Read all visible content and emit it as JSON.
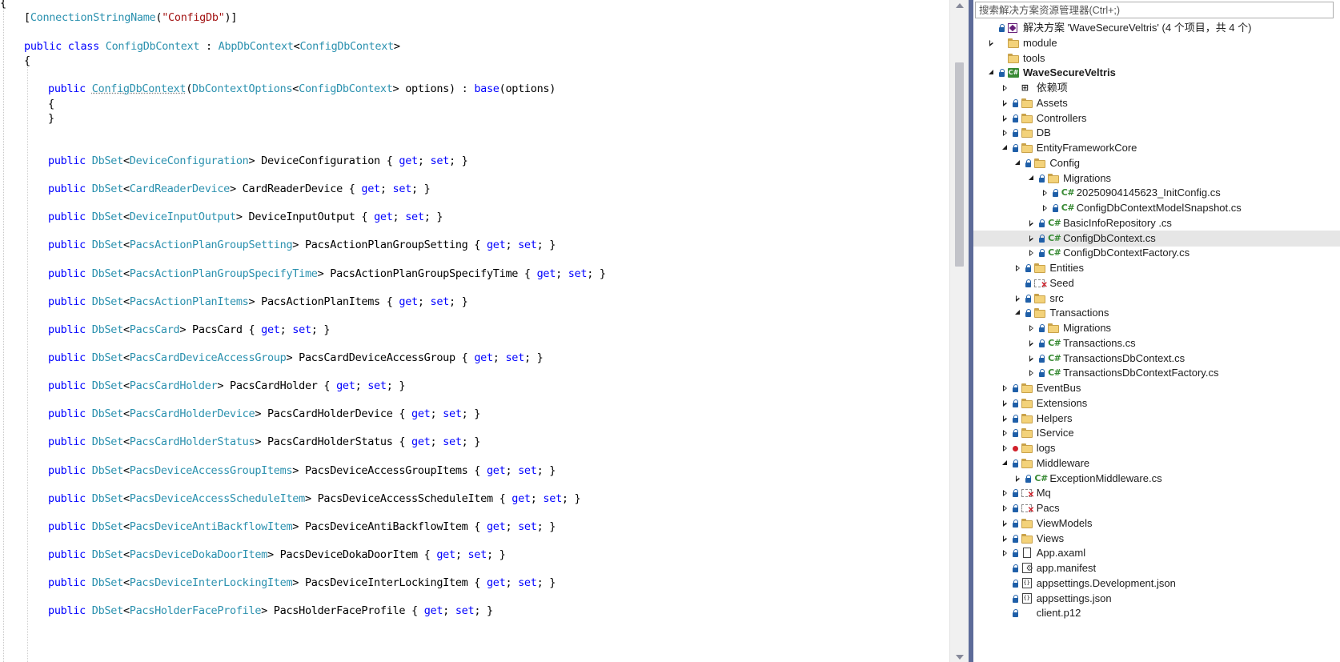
{
  "editor": {
    "lines": [
      [
        {
          "t": "[",
          "c": "pu"
        },
        {
          "t": "ConnectionStringName",
          "c": "ty"
        },
        {
          "t": "(",
          "c": "pu"
        },
        {
          "t": "\"ConfigDb\"",
          "c": "st"
        },
        {
          "t": ")]",
          "c": "pu"
        }
      ],
      [
        {
          "t": "public ",
          "c": "kw"
        },
        {
          "t": "class ",
          "c": "kw"
        },
        {
          "t": "ConfigDbContext",
          "c": "ty"
        },
        {
          "t": " : ",
          "c": "pu"
        },
        {
          "t": "AbpDbContext",
          "c": "ty"
        },
        {
          "t": "<",
          "c": "pu"
        },
        {
          "t": "ConfigDbContext",
          "c": "ty"
        },
        {
          "t": ">",
          "c": "pu"
        }
      ],
      [
        {
          "t": "{",
          "c": "pu"
        }
      ],
      [
        {
          "t": "public ",
          "c": "kw"
        },
        {
          "t": "ConfigDbContext",
          "c": "ty",
          "u": true
        },
        {
          "t": "(",
          "c": "pu"
        },
        {
          "t": "DbContextOptions",
          "c": "ty"
        },
        {
          "t": "<",
          "c": "pu"
        },
        {
          "t": "ConfigDbContext",
          "c": "ty"
        },
        {
          "t": "> options) : ",
          "c": "pu"
        },
        {
          "t": "base",
          "c": "kw"
        },
        {
          "t": "(options)",
          "c": "pu"
        }
      ],
      [
        {
          "t": "{",
          "c": "pu"
        }
      ],
      [
        {
          "t": "}",
          "c": "pu"
        }
      ],
      [
        {
          "t": "public ",
          "c": "kw"
        },
        {
          "t": "DbSet",
          "c": "ty"
        },
        {
          "t": "<",
          "c": "pu"
        },
        {
          "t": "DeviceConfiguration",
          "c": "ty"
        },
        {
          "t": "> DeviceConfiguration { ",
          "c": "pu"
        },
        {
          "t": "get",
          "c": "kw"
        },
        {
          "t": "; ",
          "c": "pu"
        },
        {
          "t": "set",
          "c": "kw"
        },
        {
          "t": "; }",
          "c": "pu"
        }
      ],
      [
        {
          "t": "public ",
          "c": "kw"
        },
        {
          "t": "DbSet",
          "c": "ty"
        },
        {
          "t": "<",
          "c": "pu"
        },
        {
          "t": "CardReaderDevice",
          "c": "ty"
        },
        {
          "t": "> CardReaderDevice { ",
          "c": "pu"
        },
        {
          "t": "get",
          "c": "kw"
        },
        {
          "t": "; ",
          "c": "pu"
        },
        {
          "t": "set",
          "c": "kw"
        },
        {
          "t": "; }",
          "c": "pu"
        }
      ],
      [
        {
          "t": "public ",
          "c": "kw"
        },
        {
          "t": "DbSet",
          "c": "ty"
        },
        {
          "t": "<",
          "c": "pu"
        },
        {
          "t": "DeviceInputOutput",
          "c": "ty"
        },
        {
          "t": "> DeviceInputOutput { ",
          "c": "pu"
        },
        {
          "t": "get",
          "c": "kw"
        },
        {
          "t": "; ",
          "c": "pu"
        },
        {
          "t": "set",
          "c": "kw"
        },
        {
          "t": "; }",
          "c": "pu"
        }
      ],
      [
        {
          "t": "public ",
          "c": "kw"
        },
        {
          "t": "DbSet",
          "c": "ty"
        },
        {
          "t": "<",
          "c": "pu"
        },
        {
          "t": "PacsActionPlanGroupSetting",
          "c": "ty"
        },
        {
          "t": "> PacsActionPlanGroupSetting { ",
          "c": "pu"
        },
        {
          "t": "get",
          "c": "kw"
        },
        {
          "t": "; ",
          "c": "pu"
        },
        {
          "t": "set",
          "c": "kw"
        },
        {
          "t": "; }",
          "c": "pu"
        }
      ],
      [
        {
          "t": "public ",
          "c": "kw"
        },
        {
          "t": "DbSet",
          "c": "ty"
        },
        {
          "t": "<",
          "c": "pu"
        },
        {
          "t": "PacsActionPlanGroupSpecifyTime",
          "c": "ty"
        },
        {
          "t": "> PacsActionPlanGroupSpecifyTime { ",
          "c": "pu"
        },
        {
          "t": "get",
          "c": "kw"
        },
        {
          "t": "; ",
          "c": "pu"
        },
        {
          "t": "set",
          "c": "kw"
        },
        {
          "t": "; }",
          "c": "pu"
        }
      ],
      [
        {
          "t": "public ",
          "c": "kw"
        },
        {
          "t": "DbSet",
          "c": "ty"
        },
        {
          "t": "<",
          "c": "pu"
        },
        {
          "t": "PacsActionPlanItems",
          "c": "ty"
        },
        {
          "t": "> PacsActionPlanItems { ",
          "c": "pu"
        },
        {
          "t": "get",
          "c": "kw"
        },
        {
          "t": "; ",
          "c": "pu"
        },
        {
          "t": "set",
          "c": "kw"
        },
        {
          "t": "; }",
          "c": "pu"
        }
      ],
      [
        {
          "t": "public ",
          "c": "kw"
        },
        {
          "t": "DbSet",
          "c": "ty"
        },
        {
          "t": "<",
          "c": "pu"
        },
        {
          "t": "PacsCard",
          "c": "ty"
        },
        {
          "t": "> PacsCard { ",
          "c": "pu"
        },
        {
          "t": "get",
          "c": "kw"
        },
        {
          "t": "; ",
          "c": "pu"
        },
        {
          "t": "set",
          "c": "kw"
        },
        {
          "t": "; }",
          "c": "pu"
        }
      ],
      [
        {
          "t": "public ",
          "c": "kw"
        },
        {
          "t": "DbSet",
          "c": "ty"
        },
        {
          "t": "<",
          "c": "pu"
        },
        {
          "t": "PacsCardDeviceAccessGroup",
          "c": "ty"
        },
        {
          "t": "> PacsCardDeviceAccessGroup { ",
          "c": "pu"
        },
        {
          "t": "get",
          "c": "kw"
        },
        {
          "t": "; ",
          "c": "pu"
        },
        {
          "t": "set",
          "c": "kw"
        },
        {
          "t": "; }",
          "c": "pu"
        }
      ],
      [
        {
          "t": "public ",
          "c": "kw"
        },
        {
          "t": "DbSet",
          "c": "ty"
        },
        {
          "t": "<",
          "c": "pu"
        },
        {
          "t": "PacsCardHolder",
          "c": "ty"
        },
        {
          "t": "> PacsCardHolder { ",
          "c": "pu"
        },
        {
          "t": "get",
          "c": "kw"
        },
        {
          "t": "; ",
          "c": "pu"
        },
        {
          "t": "set",
          "c": "kw"
        },
        {
          "t": "; }",
          "c": "pu"
        }
      ],
      [
        {
          "t": "public ",
          "c": "kw"
        },
        {
          "t": "DbSet",
          "c": "ty"
        },
        {
          "t": "<",
          "c": "pu"
        },
        {
          "t": "PacsCardHolderDevice",
          "c": "ty"
        },
        {
          "t": "> PacsCardHolderDevice { ",
          "c": "pu"
        },
        {
          "t": "get",
          "c": "kw"
        },
        {
          "t": "; ",
          "c": "pu"
        },
        {
          "t": "set",
          "c": "kw"
        },
        {
          "t": "; }",
          "c": "pu"
        }
      ],
      [
        {
          "t": "public ",
          "c": "kw"
        },
        {
          "t": "DbSet",
          "c": "ty"
        },
        {
          "t": "<",
          "c": "pu"
        },
        {
          "t": "PacsCardHolderStatus",
          "c": "ty"
        },
        {
          "t": "> PacsCardHolderStatus { ",
          "c": "pu"
        },
        {
          "t": "get",
          "c": "kw"
        },
        {
          "t": "; ",
          "c": "pu"
        },
        {
          "t": "set",
          "c": "kw"
        },
        {
          "t": "; }",
          "c": "pu"
        }
      ],
      [
        {
          "t": "public ",
          "c": "kw"
        },
        {
          "t": "DbSet",
          "c": "ty"
        },
        {
          "t": "<",
          "c": "pu"
        },
        {
          "t": "PacsDeviceAccessGroupItems",
          "c": "ty"
        },
        {
          "t": "> PacsDeviceAccessGroupItems { ",
          "c": "pu"
        },
        {
          "t": "get",
          "c": "kw"
        },
        {
          "t": "; ",
          "c": "pu"
        },
        {
          "t": "set",
          "c": "kw"
        },
        {
          "t": "; }",
          "c": "pu"
        }
      ],
      [
        {
          "t": "public ",
          "c": "kw"
        },
        {
          "t": "DbSet",
          "c": "ty"
        },
        {
          "t": "<",
          "c": "pu"
        },
        {
          "t": "PacsDeviceAccessScheduleItem",
          "c": "ty"
        },
        {
          "t": "> PacsDeviceAccessScheduleItem { ",
          "c": "pu"
        },
        {
          "t": "get",
          "c": "kw"
        },
        {
          "t": "; ",
          "c": "pu"
        },
        {
          "t": "set",
          "c": "kw"
        },
        {
          "t": "; }",
          "c": "pu"
        }
      ],
      [
        {
          "t": "public ",
          "c": "kw"
        },
        {
          "t": "DbSet",
          "c": "ty"
        },
        {
          "t": "<",
          "c": "pu"
        },
        {
          "t": "PacsDeviceAntiBackflowItem",
          "c": "ty"
        },
        {
          "t": "> PacsDeviceAntiBackflowItem { ",
          "c": "pu"
        },
        {
          "t": "get",
          "c": "kw"
        },
        {
          "t": "; ",
          "c": "pu"
        },
        {
          "t": "set",
          "c": "kw"
        },
        {
          "t": "; }",
          "c": "pu"
        }
      ],
      [
        {
          "t": "public ",
          "c": "kw"
        },
        {
          "t": "DbSet",
          "c": "ty"
        },
        {
          "t": "<",
          "c": "pu"
        },
        {
          "t": "PacsDeviceDokaDoorItem",
          "c": "ty"
        },
        {
          "t": "> PacsDeviceDokaDoorItem { ",
          "c": "pu"
        },
        {
          "t": "get",
          "c": "kw"
        },
        {
          "t": "; ",
          "c": "pu"
        },
        {
          "t": "set",
          "c": "kw"
        },
        {
          "t": "; }",
          "c": "pu"
        }
      ],
      [
        {
          "t": "public ",
          "c": "kw"
        },
        {
          "t": "DbSet",
          "c": "ty"
        },
        {
          "t": "<",
          "c": "pu"
        },
        {
          "t": "PacsDeviceInterLockingItem",
          "c": "ty"
        },
        {
          "t": "> PacsDeviceInterLockingItem { ",
          "c": "pu"
        },
        {
          "t": "get",
          "c": "kw"
        },
        {
          "t": "; ",
          "c": "pu"
        },
        {
          "t": "set",
          "c": "kw"
        },
        {
          "t": "; }",
          "c": "pu"
        }
      ],
      [
        {
          "t": "public ",
          "c": "kw"
        },
        {
          "t": "DbSet",
          "c": "ty"
        },
        {
          "t": "<",
          "c": "pu"
        },
        {
          "t": "PacsHolderFaceProfile",
          "c": "ty"
        },
        {
          "t": "> PacsHolderFaceProfile { ",
          "c": "pu"
        },
        {
          "t": "get",
          "c": "kw"
        },
        {
          "t": "; ",
          "c": "pu"
        },
        {
          "t": "set",
          "c": "kw"
        },
        {
          "t": "; }",
          "c": "pu"
        }
      ]
    ]
  },
  "explorer": {
    "search_placeholder": "搜索解决方案资源管理器(Ctrl+;)",
    "items": [
      {
        "label": "解决方案 'WaveSecureVeltris' (4 个项目，共 4 个)",
        "icon": "solution-icon",
        "exp": "none",
        "lock": true
      },
      {
        "label": "module",
        "icon": "folder-icon",
        "exp": "collapsed",
        "lock": false
      },
      {
        "label": "tools",
        "icon": "folder-icon",
        "exp": "none",
        "lock": false
      },
      {
        "label": "WaveSecureVeltris",
        "icon": "csharp-project-icon",
        "exp": "expanded",
        "lock": true,
        "bold": true
      },
      {
        "label": "依赖项",
        "icon": "dependencies-icon",
        "exp": "collapsed",
        "lock": false
      },
      {
        "label": "Assets",
        "icon": "folder-icon",
        "exp": "collapsed",
        "lock": true
      },
      {
        "label": "Controllers",
        "icon": "folder-icon",
        "exp": "collapsed",
        "lock": true
      },
      {
        "label": "DB",
        "icon": "folder-icon",
        "exp": "collapsed",
        "lock": true
      },
      {
        "label": "EntityFrameworkCore",
        "icon": "folder-icon",
        "exp": "expanded",
        "lock": true
      },
      {
        "label": "Config",
        "icon": "folder-icon",
        "exp": "expanded",
        "lock": true
      },
      {
        "label": "Migrations",
        "icon": "folder-icon",
        "exp": "expanded",
        "lock": true
      },
      {
        "label": "20250904145623_InitConfig.cs",
        "icon": "csharp-file-icon",
        "exp": "collapsed",
        "lock": true
      },
      {
        "label": "ConfigDbContextModelSnapshot.cs",
        "icon": "csharp-file-icon",
        "exp": "collapsed",
        "lock": true
      },
      {
        "label": "BasicInfoRepository .cs",
        "icon": "csharp-file-icon",
        "exp": "collapsed",
        "lock": true
      },
      {
        "label": "ConfigDbContext.cs",
        "icon": "csharp-file-icon",
        "exp": "collapsed",
        "lock": true,
        "selected": true
      },
      {
        "label": "ConfigDbContextFactory.cs",
        "icon": "csharp-file-icon",
        "exp": "collapsed",
        "lock": true
      },
      {
        "label": "Entities",
        "icon": "folder-icon",
        "exp": "collapsed",
        "lock": true
      },
      {
        "label": "Seed",
        "icon": "missing-folder-icon",
        "exp": "none",
        "lock": true
      },
      {
        "label": "src",
        "icon": "folder-icon",
        "exp": "collapsed",
        "lock": true
      },
      {
        "label": "Transactions",
        "icon": "folder-icon",
        "exp": "expanded",
        "lock": true
      },
      {
        "label": "Migrations",
        "icon": "folder-icon",
        "exp": "collapsed",
        "lock": true
      },
      {
        "label": "Transactions.cs",
        "icon": "csharp-file-icon",
        "exp": "collapsed",
        "lock": true
      },
      {
        "label": "TransactionsDbContext.cs",
        "icon": "csharp-file-icon",
        "exp": "collapsed",
        "lock": true
      },
      {
        "label": "TransactionsDbContextFactory.cs",
        "icon": "csharp-file-icon",
        "exp": "collapsed",
        "lock": true
      },
      {
        "label": "EventBus",
        "icon": "folder-icon",
        "exp": "collapsed",
        "lock": true
      },
      {
        "label": "Extensions",
        "icon": "folder-icon",
        "exp": "collapsed",
        "lock": true
      },
      {
        "label": "Helpers",
        "icon": "folder-icon",
        "exp": "collapsed",
        "lock": true
      },
      {
        "label": "IService",
        "icon": "folder-icon",
        "exp": "collapsed",
        "lock": true
      },
      {
        "label": "logs",
        "icon": "folder-icon",
        "exp": "collapsed",
        "lock": false,
        "error": true
      },
      {
        "label": "Middleware",
        "icon": "folder-icon",
        "exp": "expanded",
        "lock": true
      },
      {
        "label": "ExceptionMiddleware.cs",
        "icon": "csharp-file-icon",
        "exp": "collapsed",
        "lock": true
      },
      {
        "label": "Mq",
        "icon": "missing-folder-icon",
        "exp": "collapsed",
        "lock": true
      },
      {
        "label": "Pacs",
        "icon": "missing-folder-icon",
        "exp": "collapsed",
        "lock": true
      },
      {
        "label": "ViewModels",
        "icon": "folder-icon",
        "exp": "collapsed",
        "lock": true
      },
      {
        "label": "Views",
        "icon": "folder-icon",
        "exp": "collapsed",
        "lock": true
      },
      {
        "label": "App.axaml",
        "icon": "document-icon",
        "exp": "collapsed",
        "lock": true
      },
      {
        "label": "app.manifest",
        "icon": "manifest-icon",
        "exp": "none",
        "lock": true
      },
      {
        "label": "appsettings.Development.json",
        "icon": "json-icon",
        "exp": "none",
        "lock": true
      },
      {
        "label": "appsettings.json",
        "icon": "json-icon",
        "exp": "none",
        "lock": true
      },
      {
        "label": "client.p12",
        "icon": "none",
        "exp": "none",
        "lock": true
      }
    ],
    "csharp_glyph": "C#",
    "csproj_glyph": "C#",
    "dependencies_glyph": "⊞"
  }
}
